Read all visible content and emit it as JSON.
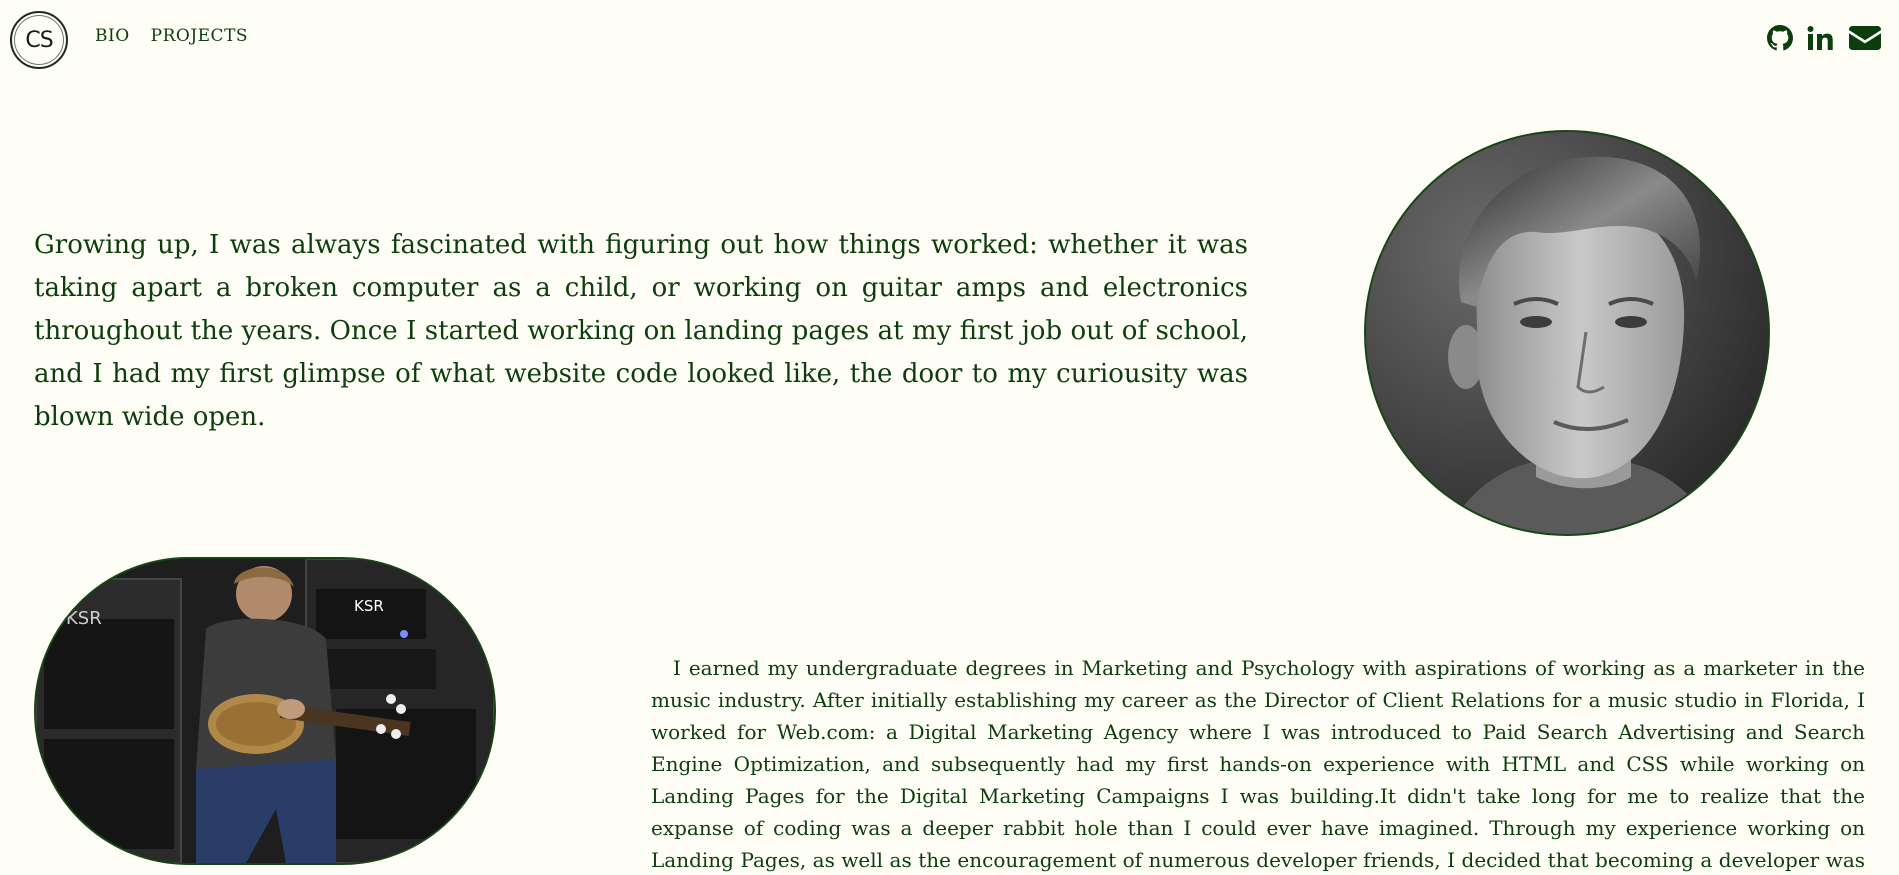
{
  "header": {
    "logo_text": "CS",
    "nav": [
      {
        "label": "BIO"
      },
      {
        "label": "PROJECTS"
      }
    ],
    "social_icons": [
      "github-icon",
      "linkedin-icon",
      "envelope-icon"
    ]
  },
  "bio": {
    "intro": "Growing up, I was always fascinated with figuring out how things worked: whether it was taking apart a broken computer as a child, or working on guitar amps and electronics throughout the years. Once I started working on landing pages at my first job out of school, and I had my first glimpse of what website code looked like, the door to my curiousity was blown wide open.",
    "story": "I earned my undergraduate degrees in Marketing and Psychology with aspirations of working as a marketer in the music industry. After initially establishing my career as the Director of Client Relations for a music studio in Florida, I worked for Web.com: a Digital Marketing Agency where I was introduced to Paid Search Advertising and Search Engine Optimization, and subsequently had my first hands-on experience with HTML and CSS while working on Landing Pages for the Digital Marketing Campaigns I was building.It didn't take long for me to realize that the expanse of coding was a deeper rabbit hole than I could ever have imagined. Through my experience working on Landing Pages, as well as the encouragement of numerous developer friends, I decided that becoming a developer was the next destination on my career path.",
    "guitar_photo_text": "KSR"
  },
  "colors": {
    "text": "#0c3d0c",
    "background": "#fffef6",
    "border": "#154715"
  }
}
